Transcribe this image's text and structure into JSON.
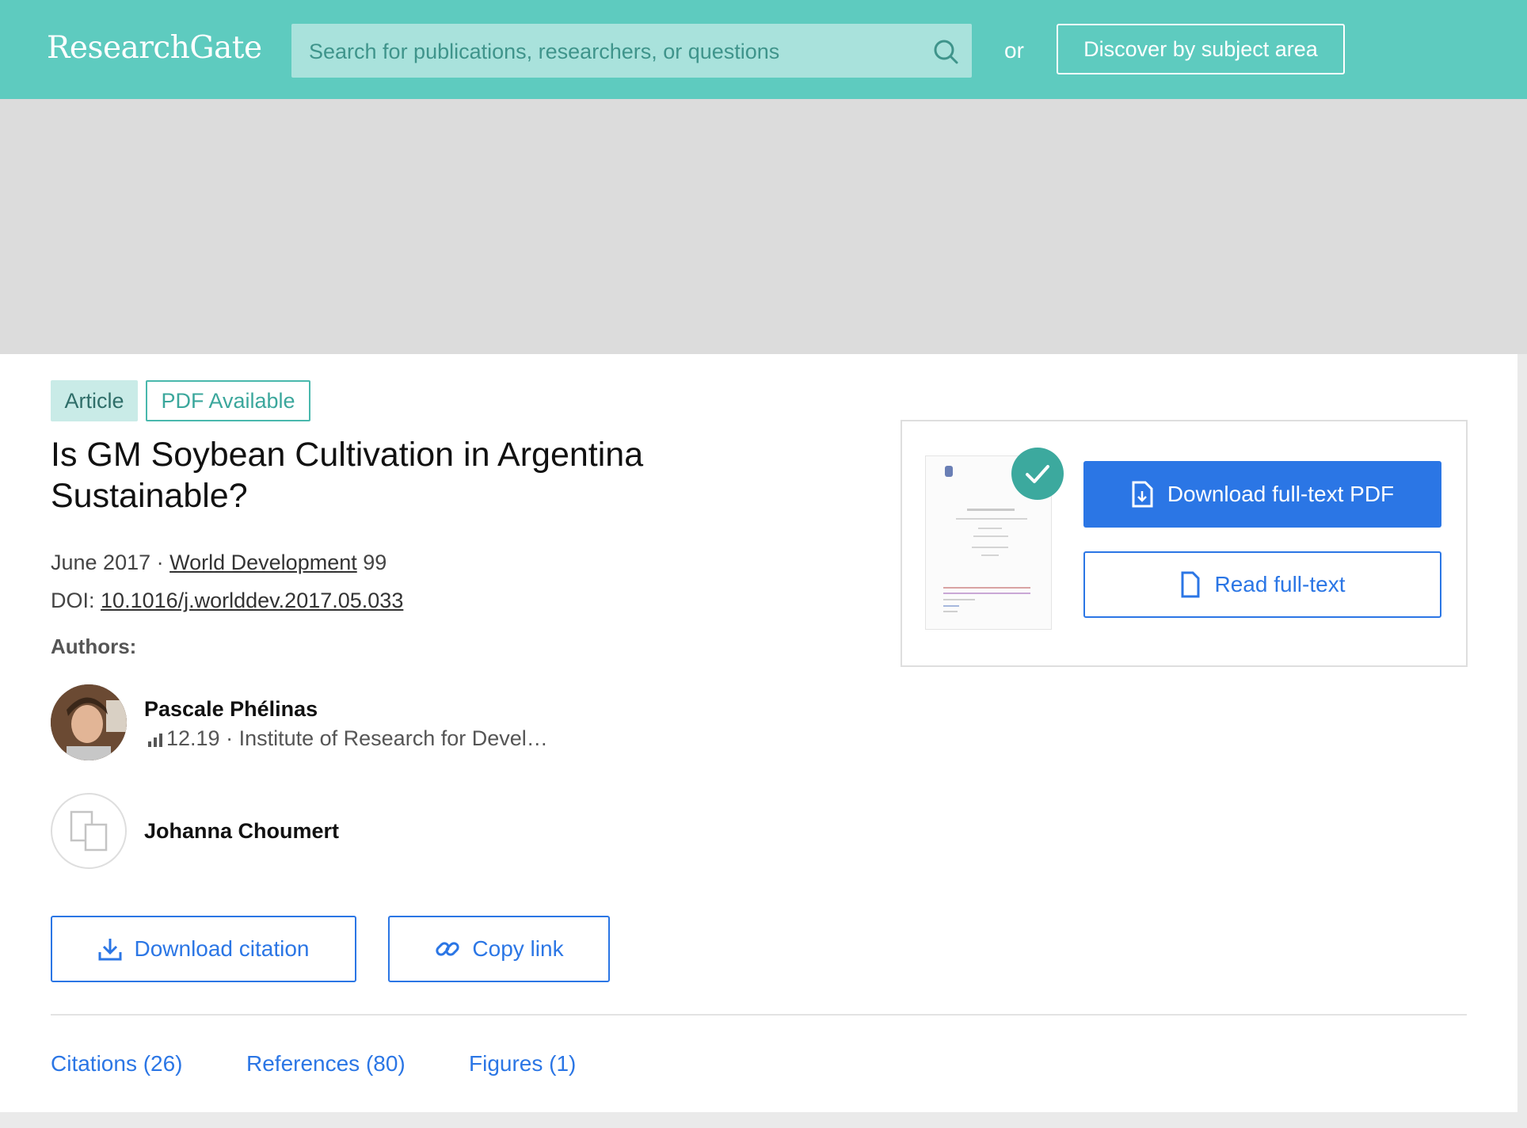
{
  "header": {
    "logo": "ResearchGate",
    "search_placeholder": "Search for publications, researchers, or questions",
    "or_text": "or",
    "discover_label": "Discover by subject area"
  },
  "publication": {
    "type_tag": "Article",
    "pdf_tag": "PDF Available",
    "title": "Is GM Soybean Cultivation in Argentina Sustainable?",
    "date": "June 2017",
    "separator": " · ",
    "journal": "World Development",
    "volume": "99",
    "doi_label": "DOI:",
    "doi": "10.1016/j.worlddev.2017.05.033",
    "authors_label": "Authors:"
  },
  "authors": [
    {
      "name": "Pascale Phélinas",
      "score": "12.19",
      "affiliation_sep": " · ",
      "affiliation": "Institute of Research for Devel…"
    },
    {
      "name": "Johanna Choumert"
    }
  ],
  "actions": {
    "download_citation": "Download citation",
    "copy_link": "Copy link",
    "download_pdf": "Download full-text PDF",
    "read_full_text": "Read full-text"
  },
  "tabs": [
    {
      "label": "Citations (26)"
    },
    {
      "label": "References (80)"
    },
    {
      "label": "Figures (1)"
    }
  ],
  "colors": {
    "brand": "#5ecbbf",
    "primary": "#2b76e5",
    "check": "#3ca99e"
  }
}
